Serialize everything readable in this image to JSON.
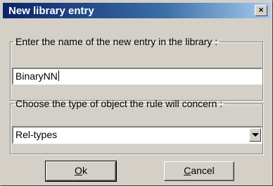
{
  "window": {
    "title": "New library entry",
    "close_glyph": "×"
  },
  "name_group": {
    "label": "Enter the name of the new entry in the library :",
    "value": "BinaryNN"
  },
  "type_group": {
    "label": "Choose the type of object the rule will concern :",
    "selected": "Rel-types"
  },
  "buttons": {
    "ok": {
      "accel": "O",
      "rest": "k"
    },
    "cancel": {
      "accel": "C",
      "rest": "ancel"
    }
  },
  "icons": {
    "close": "close-icon",
    "dropdown": "chevron-down-icon"
  },
  "colors": {
    "titlebar_start": "#0a246a",
    "titlebar_end": "#a6caf0",
    "dialog_face": "#d4d0c8"
  }
}
